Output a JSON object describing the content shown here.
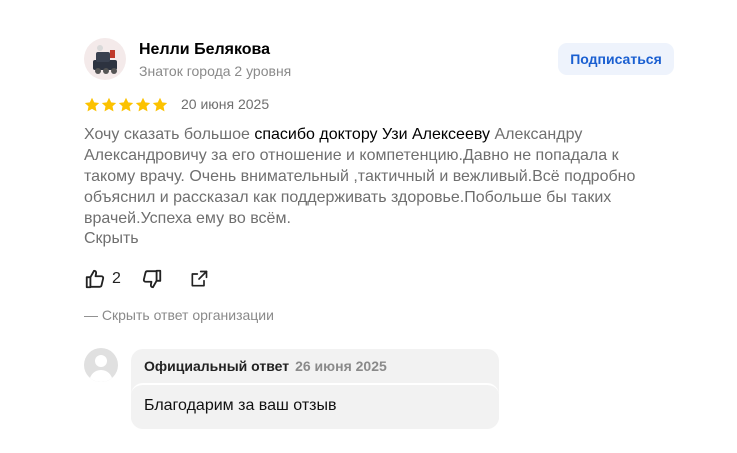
{
  "review": {
    "author_name": "Нелли Белякова",
    "author_level": "Знаток города 2 уровня",
    "subscribe_label": "Подписаться",
    "rating": 5,
    "rating_max": 5,
    "date": "20 июня 2025",
    "text_before": "Хочу сказать большое ",
    "text_highlight": "спасибо доктору Узи Алексееву",
    "text_after": " Александру Александровичу за его отношение и компетенцию.Давно не попадала к такому врачу. Очень внимательный ,тактичный и вежливый.Всё подробно объяснил и рассказал как поддерживать здоровье.Побольше бы таких врачей.Успеха ему во всём.",
    "collapse_label": "Скрыть",
    "like_count": "2"
  },
  "org_reply": {
    "toggle_label": "—  Скрыть ответ организации",
    "label": "Официальный ответ",
    "date": "26 июня 2025",
    "text": "Благодарим за ваш отзыв"
  },
  "icons": {
    "like": "thumb-up-icon",
    "dislike": "thumb-down-icon",
    "share": "share-icon",
    "star": "star-icon"
  },
  "colors": {
    "star": "#fcc200",
    "accent": "#1a5fd1",
    "subscribe_bg": "#eef3fc",
    "muted_text": "#6f6f6f",
    "reply_bg": "#f2f2f2"
  }
}
